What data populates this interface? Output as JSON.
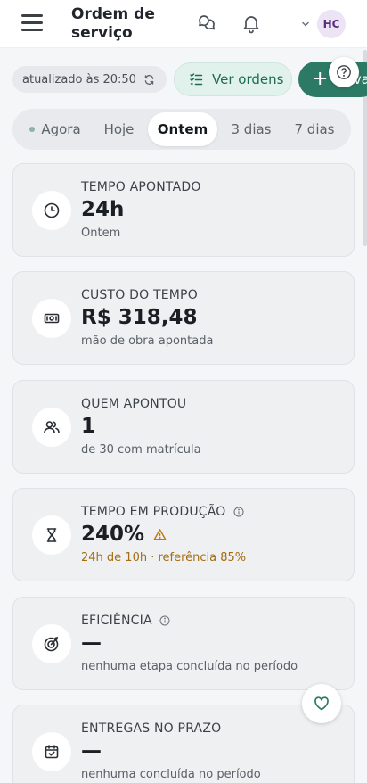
{
  "header": {
    "title": "Ordem de serviço",
    "chat_icon": "chat-bubbles-icon",
    "bell_icon": "bell-icon",
    "avatar_initials": "HC"
  },
  "actions": {
    "updated_label": "atualizado às 20:50",
    "view_orders_label": "Ver ordens",
    "new_label": "Nova"
  },
  "tabs": [
    {
      "label": "Agora",
      "active": false
    },
    {
      "label": "Hoje",
      "active": false
    },
    {
      "label": "Ontem",
      "active": true
    },
    {
      "label": "3 dias",
      "active": false
    },
    {
      "label": "7 dias",
      "active": false
    }
  ],
  "cards": [
    {
      "label": "TEMPO APONTADO",
      "value": "24h",
      "sub": "Ontem",
      "icon": "clock-icon"
    },
    {
      "label": "CUSTO DO TEMPO",
      "value": "R$ 318,48",
      "sub": "mão de obra apontada",
      "icon": "money-icon"
    },
    {
      "label": "QUEM APONTOU",
      "value": "1",
      "sub": "de 30 com matrícula",
      "icon": "users-icon"
    },
    {
      "label": "TEMPO EM PRODUÇÃO",
      "value": "240%",
      "sub": "24h de 10h · referência 85%",
      "icon": "hourglass-icon",
      "warning": true
    },
    {
      "label": "EFICIÊNCIA",
      "value": "—",
      "sub": "nenhuma etapa concluída no período",
      "icon": "target-icon"
    },
    {
      "label": "ENTREGAS NO PRAZO",
      "value": "—",
      "sub": "nenhuma concluída no período",
      "icon": "calendar-check-icon"
    }
  ],
  "colors": {
    "accent": "#2c7a66",
    "accent_light": "#e1f1ec",
    "warning": "#a46d12",
    "avatar_bg": "#ece3f5",
    "avatar_text": "#5a2d82"
  }
}
